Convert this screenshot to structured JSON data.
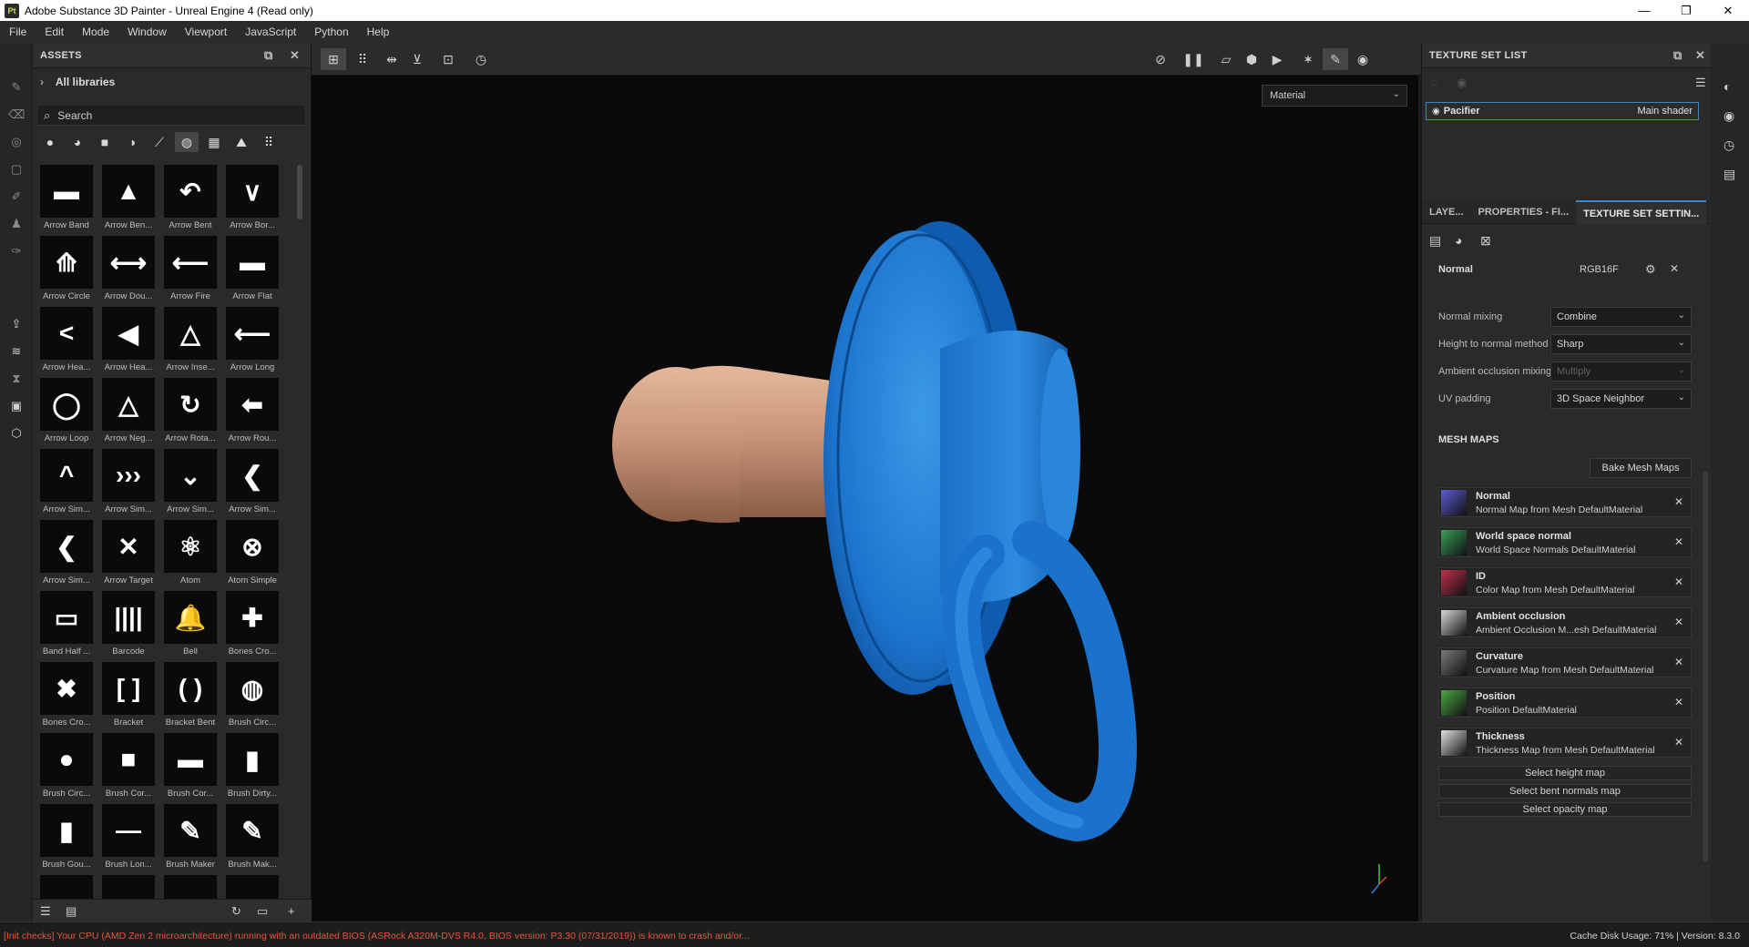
{
  "window": {
    "title": "Adobe Substance 3D Painter - Unreal Engine 4 (Read only)",
    "app_icon": "Pt",
    "minimize": "—",
    "maximize": "❐",
    "close": "✕"
  },
  "menu": [
    "File",
    "Edit",
    "Mode",
    "Window",
    "Viewport",
    "JavaScript",
    "Python",
    "Help"
  ],
  "assets": {
    "title": "ASSETS",
    "library": "All libraries",
    "search_placeholder": "Search",
    "items": [
      {
        "label": "Arrow Band",
        "glyph": "▬"
      },
      {
        "label": "Arrow Ben...",
        "glyph": "▲"
      },
      {
        "label": "Arrow Bent",
        "glyph": "↶"
      },
      {
        "label": "Arrow Bor...",
        "glyph": "∨"
      },
      {
        "label": "Arrow Circle",
        "glyph": "⟰"
      },
      {
        "label": "Arrow Dou...",
        "glyph": "⟷"
      },
      {
        "label": "Arrow Fire",
        "glyph": "⟵"
      },
      {
        "label": "Arrow Flat",
        "glyph": "▬"
      },
      {
        "label": "Arrow Hea...",
        "glyph": "<"
      },
      {
        "label": "Arrow Hea...",
        "glyph": "◀"
      },
      {
        "label": "Arrow Inse...",
        "glyph": "△"
      },
      {
        "label": "Arrow Long",
        "glyph": "⟵"
      },
      {
        "label": "Arrow Loop",
        "glyph": "◯"
      },
      {
        "label": "Arrow Neg...",
        "glyph": "△"
      },
      {
        "label": "Arrow Rota...",
        "glyph": "↻"
      },
      {
        "label": "Arrow Rou...",
        "glyph": "⬅"
      },
      {
        "label": "Arrow Sim...",
        "glyph": "^"
      },
      {
        "label": "Arrow Sim...",
        "glyph": "›››"
      },
      {
        "label": "Arrow Sim...",
        "glyph": "⌄"
      },
      {
        "label": "Arrow Sim...",
        "glyph": "❮"
      },
      {
        "label": "Arrow Sim...",
        "glyph": "❮"
      },
      {
        "label": "Arrow Target",
        "glyph": "✕"
      },
      {
        "label": "Atom",
        "glyph": "⚛"
      },
      {
        "label": "Atom Simple",
        "glyph": "⊗"
      },
      {
        "label": "Band Half ...",
        "glyph": "▭"
      },
      {
        "label": "Barcode",
        "glyph": "||||"
      },
      {
        "label": "Bell",
        "glyph": "🔔"
      },
      {
        "label": "Bones Cro...",
        "glyph": "✚"
      },
      {
        "label": "Bones Cro...",
        "glyph": "✖"
      },
      {
        "label": "Bracket",
        "glyph": "[ ]"
      },
      {
        "label": "Bracket Bent",
        "glyph": "( )"
      },
      {
        "label": "Brush Circ...",
        "glyph": "◍"
      },
      {
        "label": "Brush Circ...",
        "glyph": "●"
      },
      {
        "label": "Brush Cor...",
        "glyph": "■"
      },
      {
        "label": "Brush Cor...",
        "glyph": "▬"
      },
      {
        "label": "Brush Dirty...",
        "glyph": "▮"
      },
      {
        "label": "Brush Gou...",
        "glyph": "▮"
      },
      {
        "label": "Brush Lon...",
        "glyph": "—"
      },
      {
        "label": "Brush Maker",
        "glyph": "✎"
      },
      {
        "label": "Brush Mak...",
        "glyph": "✎"
      }
    ]
  },
  "viewport": {
    "material_mode": "Material"
  },
  "texture_set_list": {
    "title": "TEXTURE SET LIST",
    "item_name": "Pacifier",
    "item_shader": "Main shader"
  },
  "tabs": [
    "LAYE...",
    "PROPERTIES - FI...",
    "TEXTURE SET SETTIN..."
  ],
  "settings": {
    "normal_label": "Normal",
    "normal_format": "RGB16F",
    "rows": [
      {
        "label": "Normal mixing",
        "value": "Combine"
      },
      {
        "label": "Height to normal method",
        "value": "Sharp"
      },
      {
        "label": "Ambient occlusion mixing",
        "value": "Multiply"
      },
      {
        "label": "UV padding",
        "value": "3D Space Neighbor"
      }
    ]
  },
  "mesh_maps": {
    "title": "MESH MAPS",
    "bake_button": "Bake Mesh Maps",
    "items": [
      {
        "name": "Normal",
        "source": "Normal Map from Mesh DefaultMaterial",
        "color": "#5b5bd6"
      },
      {
        "name": "World space normal",
        "source": "World Space Normals DefaultMaterial",
        "color": "#3aa05a"
      },
      {
        "name": "ID",
        "source": "Color Map from Mesh DefaultMaterial",
        "color": "#c0304a"
      },
      {
        "name": "Ambient occlusion",
        "source": "Ambient Occlusion M...esh DefaultMaterial",
        "color": "#d8d8d8"
      },
      {
        "name": "Curvature",
        "source": "Curvature Map from Mesh DefaultMaterial",
        "color": "#7a7a7a"
      },
      {
        "name": "Position",
        "source": "Position DefaultMaterial",
        "color": "#4aa840"
      },
      {
        "name": "Thickness",
        "source": "Thickness Map from Mesh DefaultMaterial",
        "color": "#e0e0e0"
      }
    ],
    "select_height": "Select height map",
    "select_bent": "Select bent normals map",
    "select_opacity": "Select opacity map"
  },
  "status": {
    "left": "[Init checks] Your CPU (AMD Zen 2 microarchitecture) running with an outdated BIOS (ASRock A320M-DVS R4.0, BIOS version: P3.30 (07/31/2019)) is known to crash and/or...",
    "right": "Cache Disk Usage:   71% | Version: 8.3.0"
  }
}
